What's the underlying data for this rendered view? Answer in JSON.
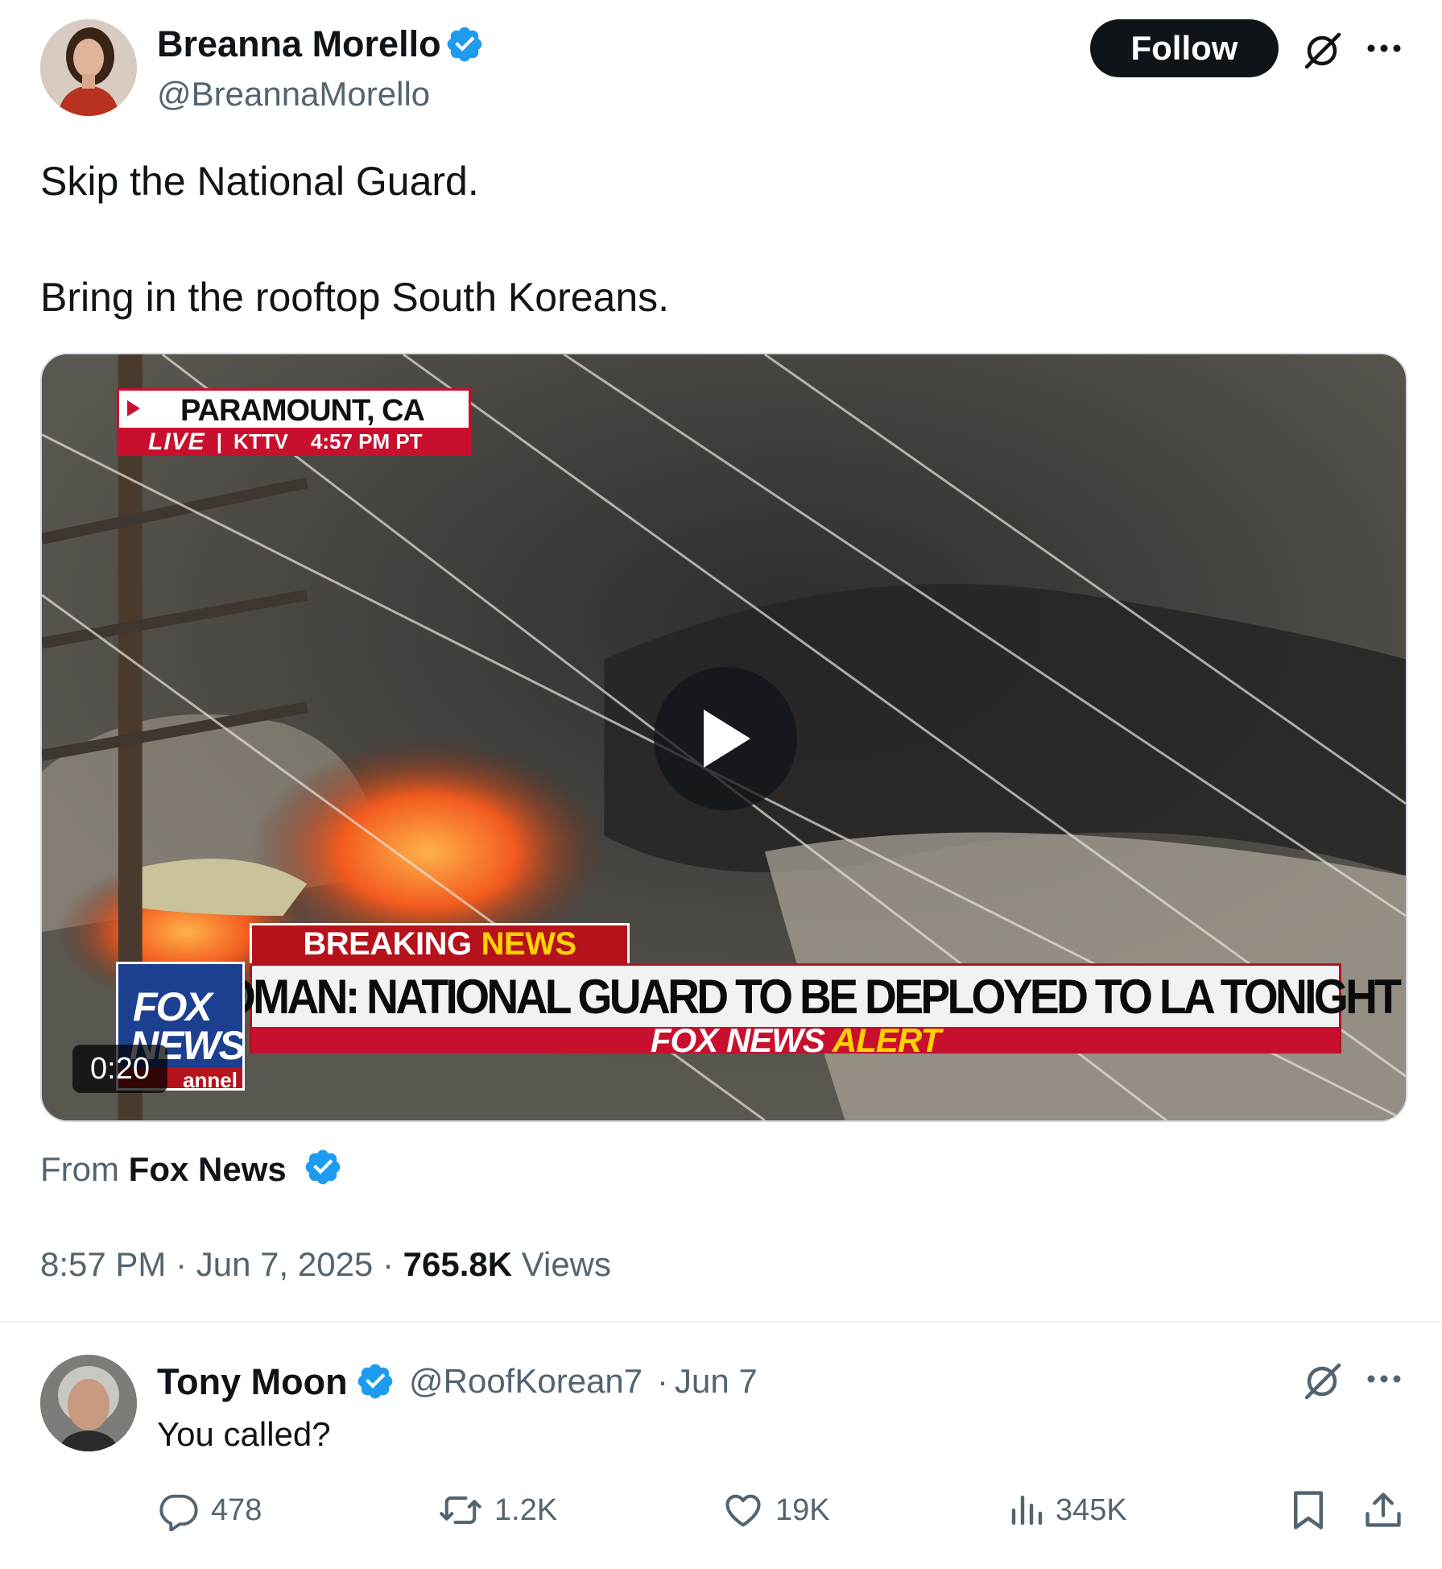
{
  "post": {
    "author_name": "Breanna Morello",
    "author_handle": "@BreannaMorello",
    "follow_label": "Follow",
    "text_line1": "Skip the National Guard.",
    "text_line2": "Bring in the rooftop South Koreans.",
    "media": {
      "location": "PARAMOUNT, CA",
      "live_label": "LIVE",
      "station": "KTTV",
      "broadcast_time": "4:57 PM PT",
      "breaking": "BREAKING",
      "breaking_news": "NEWS",
      "headline": "HOMAN: NATIONAL GUARD TO BE DEPLOYED TO LA TONIGHT",
      "alert_fox_news": "FOX NEWS",
      "alert_word": "ALERT",
      "logo_line1": "FOX",
      "logo_line2": "NEWS",
      "logo_line3": "annel",
      "duration": "0:20"
    },
    "from_prefix": "From",
    "from_source": "Fox News",
    "time": "8:57 PM",
    "date": "Jun 7, 2025",
    "views_count": "765.8K",
    "views_label": "Views",
    "separator": "·"
  },
  "reply": {
    "author_name": "Tony Moon",
    "author_handle": "@RoofKorean7",
    "date": "Jun 7",
    "text": "You called?",
    "replies": "478",
    "reposts": "1.2K",
    "likes": "19K",
    "views": "345K"
  },
  "icons": [
    "verified-badge-icon",
    "grok-icon",
    "more-icon",
    "play-icon",
    "reply-icon",
    "repost-icon",
    "like-icon",
    "views-icon",
    "bookmark-icon",
    "share-icon"
  ],
  "colors": {
    "verified": "#1d9bf0",
    "text_primary": "#0f1419",
    "text_secondary": "#536471",
    "follow_bg": "#0f1419",
    "fox_red": "#c8102e",
    "fox_blue": "#1d3f8f"
  }
}
